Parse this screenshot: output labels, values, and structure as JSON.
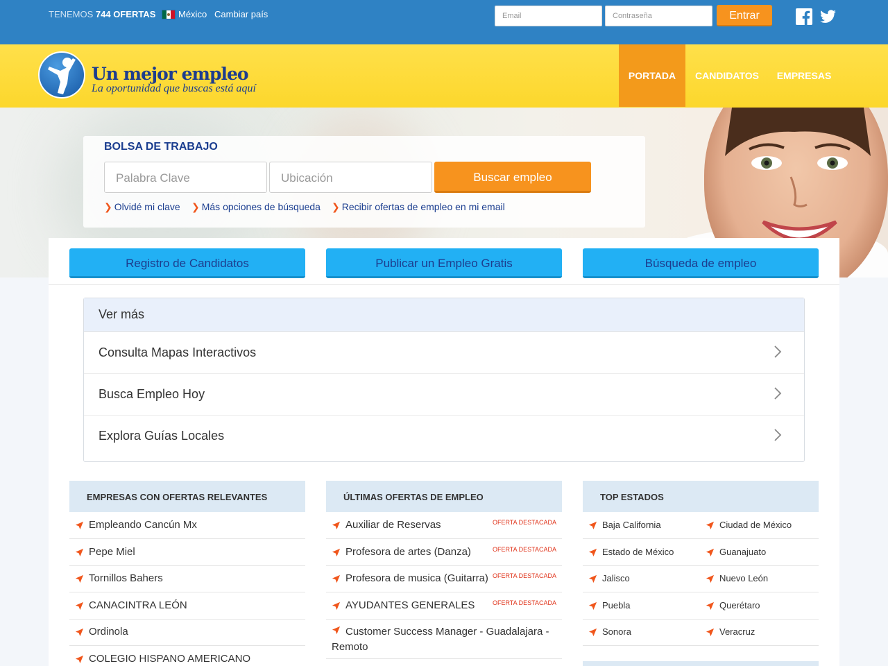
{
  "topbar": {
    "offers_prefix": "TENEMOS",
    "offers_count": "744 OFERTAS",
    "country": "México",
    "change_country": "Cambiar país",
    "email_placeholder": "Email",
    "password_placeholder": "Contraseña",
    "login_label": "Entrar"
  },
  "header": {
    "logo_title": "Un mejor empleo",
    "logo_subtitle": "La oportunidad que buscas está aquí",
    "nav": [
      "PORTADA",
      "CANDIDATOS",
      "EMPRESAS"
    ]
  },
  "search": {
    "title": "BOLSA DE TRABAJO",
    "keyword_placeholder": "Palabra Clave",
    "location_placeholder": "Ubicación",
    "button": "Buscar empleo",
    "links": [
      "Olvidé mi clave",
      "Más opciones de búsqueda",
      "Recibir ofertas de empleo en mi email"
    ]
  },
  "actions": [
    "Registro de Candidatos",
    "Publicar un Empleo Gratis",
    "Búsqueda de empleo"
  ],
  "ver_mas": {
    "title": "Ver más",
    "items": [
      "Consulta Mapas Interactivos",
      "Busca Empleo Hoy",
      "Explora Guías Locales"
    ]
  },
  "companies": {
    "title": "EMPRESAS CON OFERTAS RELEVANTES",
    "items": [
      "Empleando Cancún Mx",
      "Pepe Miel",
      "Tornillos Bahers",
      "CANACINTRA LEÓN",
      "Ordinola",
      "COLEGIO HISPANO AMERICANO"
    ]
  },
  "latest": {
    "title": "ÚLTIMAS OFERTAS DE EMPLEO",
    "badge": "OFERTA DESTACADA",
    "items": [
      "Auxiliar de Reservas",
      "Profesora de artes (Danza)",
      "Profesora de musica (Guitarra)",
      "AYUDANTES GENERALES",
      "Customer Success Manager - Guadalajara - Remoto"
    ]
  },
  "states": {
    "title": "TOP ESTADOS",
    "items": [
      "Baja California",
      "Ciudad de México",
      "Estado de México",
      "Guanajuato",
      "Jalisco",
      "Nuevo León",
      "Puebla",
      "Querétaro",
      "Sonora",
      "Veracruz"
    ]
  },
  "colors": {
    "topbar": "#2f82c4",
    "header": "#fcd72c",
    "accent": "#f7931e",
    "action": "#22b0f4",
    "brand": "#1d3d8e"
  }
}
